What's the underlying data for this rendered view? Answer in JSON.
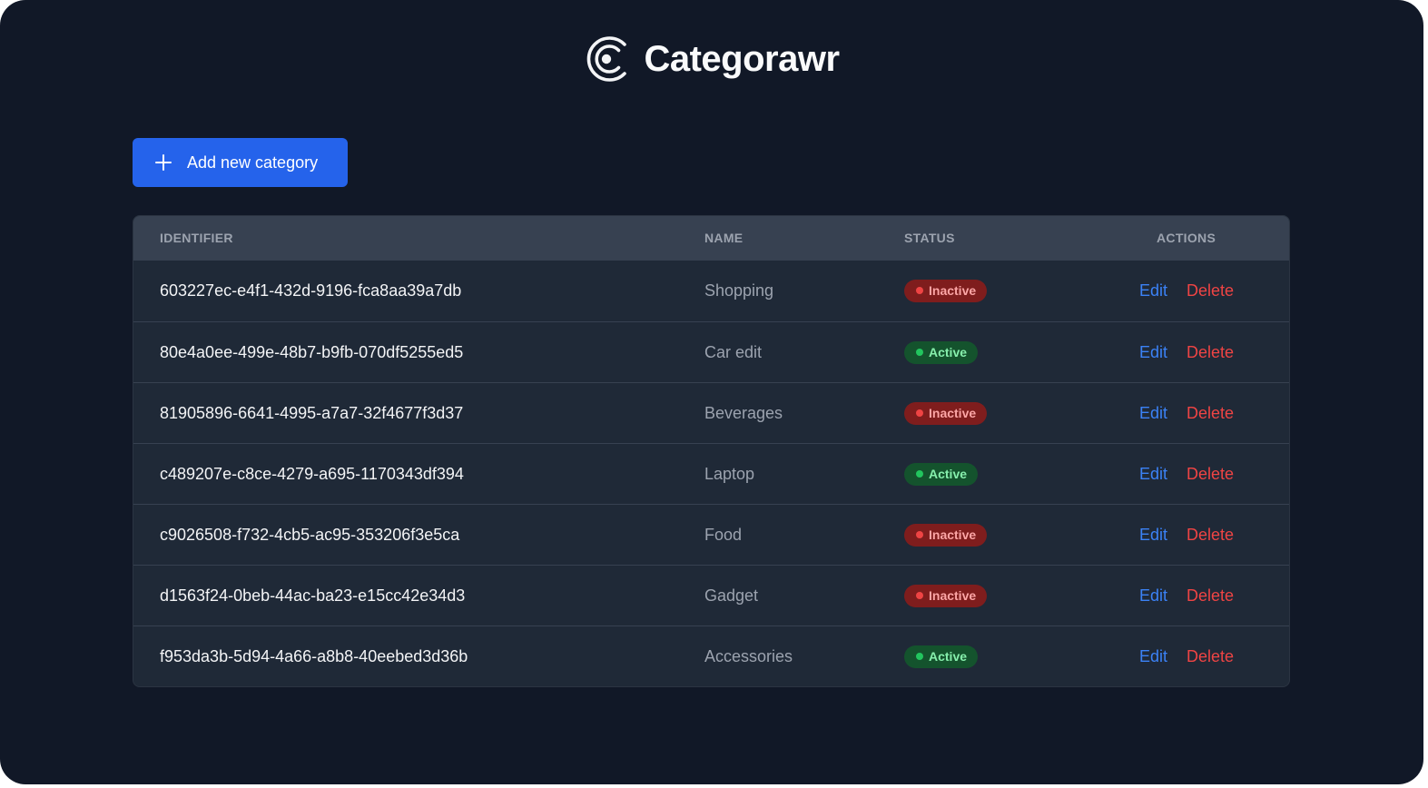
{
  "app": {
    "name": "Categorawr",
    "logo_icon": "categorawr-logo-icon"
  },
  "toolbar": {
    "add_label": "Add new category",
    "add_icon": "plus-icon"
  },
  "table": {
    "headers": {
      "identifier": "IDENTIFIER",
      "name": "NAME",
      "status": "STATUS",
      "actions": "ACTIONS"
    },
    "rows": [
      {
        "id": "603227ec-e4f1-432d-9196-fca8aa39a7db",
        "name": "Shopping",
        "status": "Inactive",
        "edit": "Edit",
        "delete": "Delete"
      },
      {
        "id": "80e4a0ee-499e-48b7-b9fb-070df5255ed5",
        "name": "Car edit",
        "status": "Active",
        "edit": "Edit",
        "delete": "Delete"
      },
      {
        "id": "81905896-6641-4995-a7a7-32f4677f3d37",
        "name": "Beverages",
        "status": "Inactive",
        "edit": "Edit",
        "delete": "Delete"
      },
      {
        "id": "c489207e-c8ce-4279-a695-1170343df394",
        "name": "Laptop",
        "status": "Active",
        "edit": "Edit",
        "delete": "Delete"
      },
      {
        "id": "c9026508-f732-4cb5-ac95-353206f3e5ca",
        "name": "Food",
        "status": "Inactive",
        "edit": "Edit",
        "delete": "Delete"
      },
      {
        "id": "d1563f24-0beb-44ac-ba23-e15cc42e34d3",
        "name": "Gadget",
        "status": "Inactive",
        "edit": "Edit",
        "delete": "Delete"
      },
      {
        "id": "f953da3b-5d94-4a66-a8b8-40eebed3d36b",
        "name": "Accessories",
        "status": "Active",
        "edit": "Edit",
        "delete": "Delete"
      }
    ]
  },
  "colors": {
    "background": "#111827",
    "table_bg": "#1f2937",
    "header_bg": "#374151",
    "primary": "#2563eb",
    "edit_link": "#3b82f6",
    "delete_link": "#ef4444",
    "active": "#22c55e",
    "inactive": "#ef4444"
  }
}
